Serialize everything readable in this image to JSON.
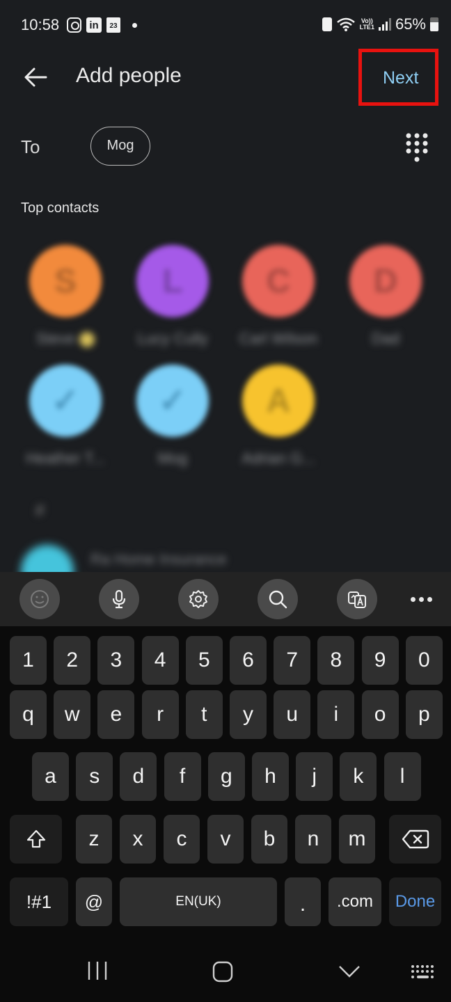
{
  "status_bar": {
    "time": "10:58",
    "notification_icons": [
      "instagram-icon",
      "linkedin-icon",
      "calendar-icon",
      "dot-icon"
    ],
    "calendar_day": "23",
    "linkedin_label": "in",
    "volte_line1": "Vo))",
    "volte_line2": "LTE1",
    "battery_percent": "65%",
    "battery_level": 0.65
  },
  "app_bar": {
    "title": "Add people",
    "next_label": "Next",
    "highlight_color": "#e8120f"
  },
  "to_row": {
    "label": "To",
    "chips": [
      {
        "label": "Mog"
      }
    ]
  },
  "top_contacts": {
    "title": "Top contacts",
    "contacts": [
      {
        "initial": "S",
        "name": "Steve",
        "color": "#f28a3c",
        "selected": false,
        "starred": true
      },
      {
        "initial": "L",
        "name": "Lucy Cully",
        "color": "#a55ae8",
        "selected": false,
        "starred": false
      },
      {
        "initial": "C",
        "name": "Carl Wilson",
        "color": "#e8655a",
        "selected": false,
        "starred": false
      },
      {
        "initial": "D",
        "name": "Dad",
        "color": "#e8655a",
        "selected": false,
        "starred": false
      },
      {
        "initial": "✓",
        "name": "Heather T...",
        "color": "#7ccff7",
        "selected": true,
        "starred": false
      },
      {
        "initial": "✓",
        "name": "Mog",
        "color": "#7ccff7",
        "selected": true,
        "starred": false
      },
      {
        "initial": "A",
        "name": "Adrian G...",
        "color": "#f7c32e",
        "selected": false,
        "starred": false
      }
    ]
  },
  "contact_list": {
    "section_letter": "#",
    "items": [
      {
        "name": "Ra Home Insurance",
        "color": "#45c4dc"
      }
    ]
  },
  "keyboard_toolbar": {
    "buttons": [
      "emoji-icon",
      "microphone-icon",
      "settings-icon",
      "search-icon",
      "translate-icon",
      "more-icon"
    ]
  },
  "keyboard": {
    "number_row": [
      "1",
      "2",
      "3",
      "4",
      "5",
      "6",
      "7",
      "8",
      "9",
      "0"
    ],
    "row1": [
      "q",
      "w",
      "e",
      "r",
      "t",
      "y",
      "u",
      "i",
      "o",
      "p"
    ],
    "row2": [
      "a",
      "s",
      "d",
      "f",
      "g",
      "h",
      "j",
      "k",
      "l"
    ],
    "row3": [
      "z",
      "x",
      "c",
      "v",
      "b",
      "n",
      "m"
    ],
    "symbols_label": "!#1",
    "at_label": "@",
    "space_label": "EN(UK)",
    "period_label": ".",
    "dotcom_label": ".com",
    "done_label": "Done",
    "done_color": "#5a9ae8"
  },
  "nav_bar": {
    "buttons": [
      "recents-icon",
      "home-icon",
      "hide-keyboard-icon",
      "keyboard-switch-icon"
    ]
  }
}
